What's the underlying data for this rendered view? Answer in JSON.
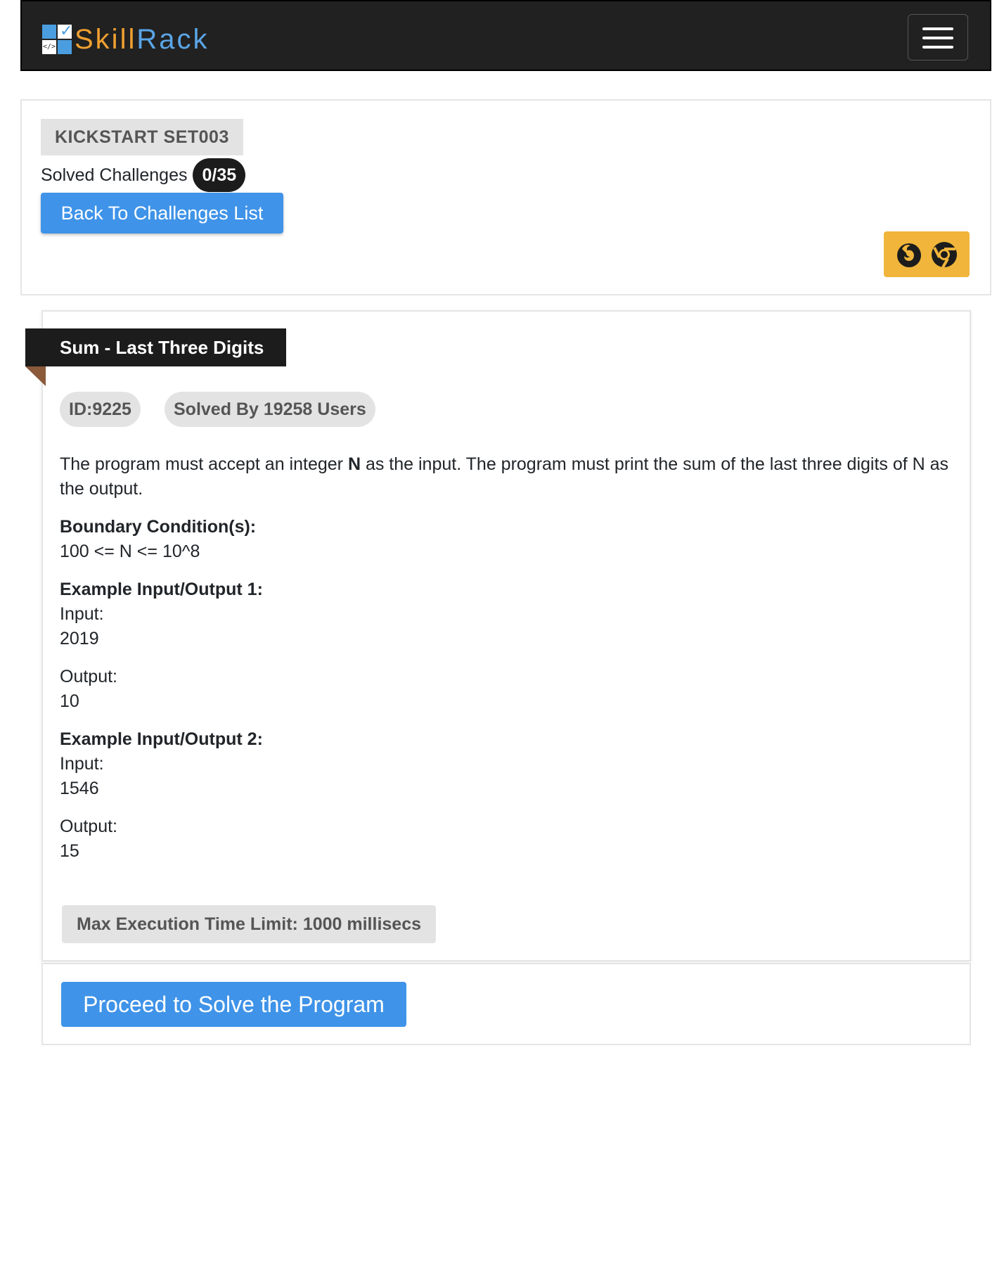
{
  "brand": {
    "skill": "Skill",
    "rack": "Rack",
    "logo_code": "</>"
  },
  "set": {
    "name": "KICKSTART SET003"
  },
  "solved": {
    "label": "Solved Challenges",
    "value": "0/35"
  },
  "buttons": {
    "back": "Back To Challenges List",
    "proceed": "Proceed to Solve the Program"
  },
  "browsers": [
    "firefox-icon",
    "chrome-icon"
  ],
  "challenge": {
    "title": "Sum - Last Three Digits",
    "id": "ID:9225",
    "solved_by": "Solved By 19258 Users",
    "desc_a": "The program must accept an integer ",
    "desc_b": "N",
    "desc_c": " as the input. The program must print the sum of the last three digits of N as the output.",
    "boundary_heading": "Boundary Condition(s):",
    "boundary": "100 <= N <= 10^8",
    "ex1_heading": "Example Input/Output 1:",
    "ex1_input_label": "Input:",
    "ex1_input": "2019",
    "ex1_output_label": "Output:",
    "ex1_output": "10",
    "ex2_heading": "Example Input/Output 2:",
    "ex2_input_label": "Input:",
    "ex2_input": "1546",
    "ex2_output_label": "Output:",
    "ex2_output": "15",
    "time_limit": "Max Execution Time Limit: 1000 millisecs"
  },
  "colors": {
    "primary": "#3f93e8",
    "navbar": "#212121",
    "browser_badge": "#f0b53a"
  }
}
